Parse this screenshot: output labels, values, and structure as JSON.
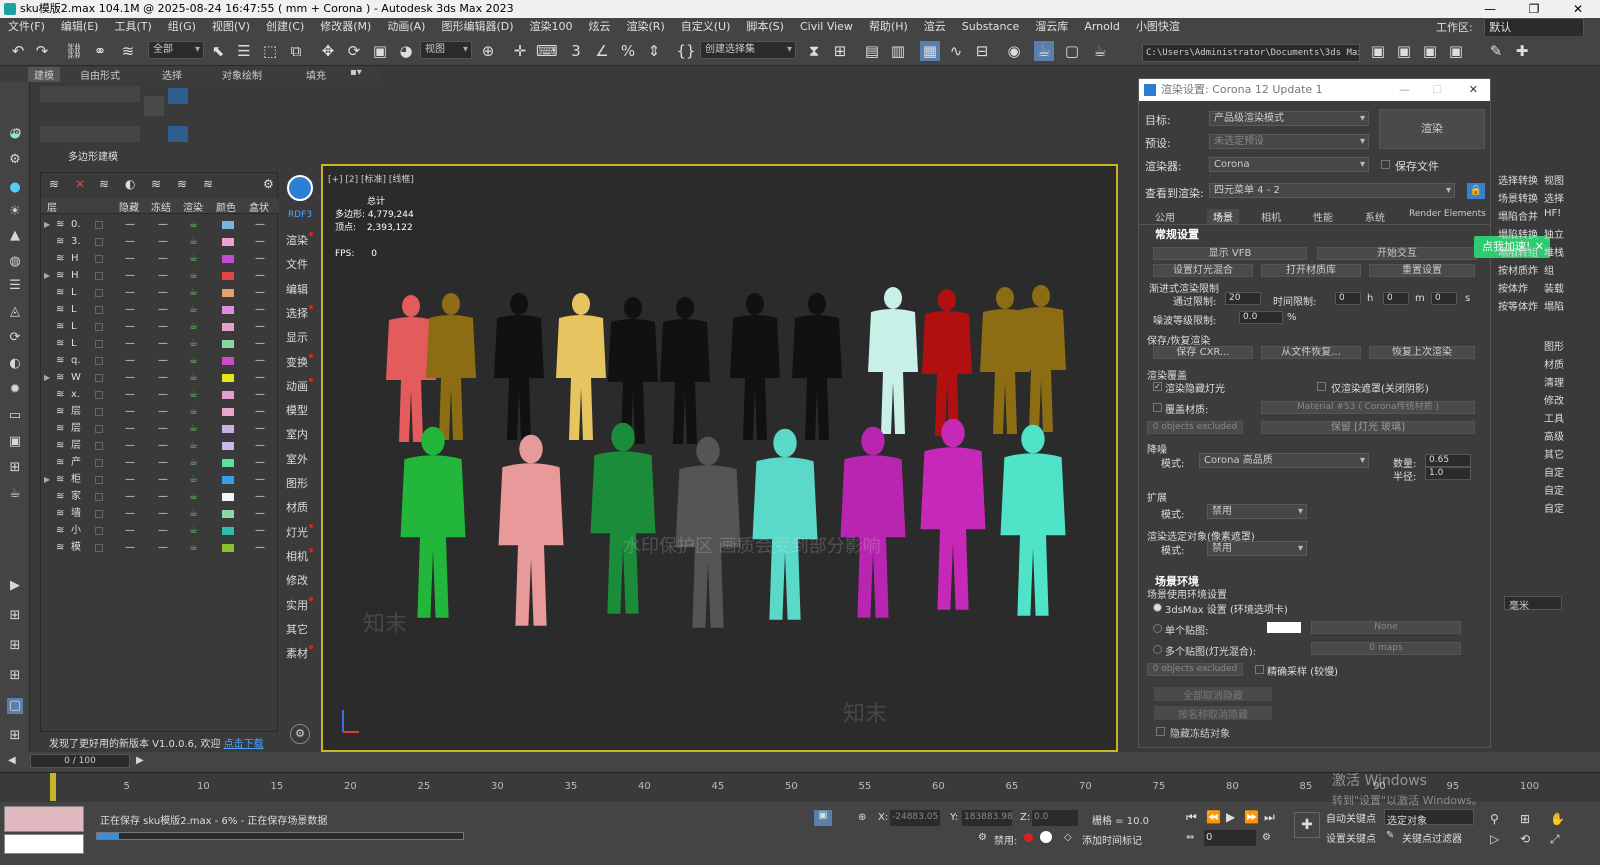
{
  "titlebar": {
    "title": "sku模版2.max   104.1M @ 2025-08-24 16:47:55  ( mm + Corona ) - Autodesk 3ds Max 2023"
  },
  "menubar": {
    "items": [
      "文件(F)",
      "编辑(E)",
      "工具(T)",
      "组(G)",
      "视图(V)",
      "创建(C)",
      "修改器(M)",
      "动画(A)",
      "图形编辑器(D)",
      "渲染100",
      "炫云",
      "渲染(R)",
      "自定义(U)",
      "脚本(S)",
      "Civil View",
      "帮助(H)",
      "渲云",
      "Substance",
      "溜云库",
      "Arnold",
      "小图快渲"
    ],
    "workspace_label": "工作区:",
    "workspace_value": "默认"
  },
  "toolbar": {
    "selection_filter": "全部",
    "ref_coord": "视图",
    "named_selection": "创建选择集",
    "project_path": "C:\\Users\\Administrator\\Documents\\3ds Max 2023"
  },
  "command_tabs": [
    "建模",
    "自由形式",
    "选择",
    "对象绘制",
    "填充"
  ],
  "create_panel": {
    "subtitle": "多边形建模"
  },
  "layer_panel": {
    "columns": [
      "层",
      "隐藏",
      "冻结",
      "渲染",
      "颜色",
      "盒状"
    ],
    "rows": [
      {
        "name": "0.",
        "color": "#7ab4e0",
        "expand": "▶"
      },
      {
        "name": "3.",
        "color": "#e7a3d6",
        "expand": ""
      },
      {
        "name": "H",
        "color": "#c44ccd",
        "expand": ""
      },
      {
        "name": "H",
        "color": "#e04646",
        "expand": "▶"
      },
      {
        "name": "L",
        "color": "#e2a366",
        "expand": ""
      },
      {
        "name": "L",
        "color": "#e08de0",
        "expand": ""
      },
      {
        "name": "L",
        "color": "#e5a0c8",
        "expand": ""
      },
      {
        "name": "L",
        "color": "#88d8a0",
        "expand": ""
      },
      {
        "name": "q.",
        "color": "#c84ccc",
        "expand": ""
      },
      {
        "name": "W",
        "color": "#e6e61c",
        "expand": "▶"
      },
      {
        "name": "x.",
        "color": "#e29fce",
        "expand": ""
      },
      {
        "name": "层",
        "color": "#e6a8cc",
        "expand": ""
      },
      {
        "name": "层",
        "color": "#c8b0e6",
        "expand": ""
      },
      {
        "name": "层",
        "color": "#c6b8e8",
        "expand": ""
      },
      {
        "name": "产",
        "color": "#5ce0a0",
        "expand": ""
      },
      {
        "name": "柜",
        "color": "#3a9fe0",
        "expand": "▶"
      },
      {
        "name": "家",
        "color": "#f4f4f4",
        "expand": ""
      },
      {
        "name": "墙",
        "color": "#8ad8a0",
        "expand": ""
      },
      {
        "name": "小",
        "color": "#2fbcae",
        "expand": ""
      },
      {
        "name": "模",
        "color": "#8abf2e",
        "expand": ""
      }
    ],
    "update_note": "发现了更好用的新版本 V1.0.0.6, 欢迎",
    "update_link": "点击下载"
  },
  "rdf_panel": {
    "title": "RDF3",
    "items": [
      "渲染",
      "文件",
      "编辑",
      "选择",
      "显示",
      "变换",
      "动画",
      "模型",
      "室内",
      "室外",
      "图形",
      "材质",
      "灯光",
      "相机",
      "修改",
      "实用",
      "其它",
      "素材"
    ]
  },
  "viewport": {
    "label": "[+] [2] [标准] [线框]",
    "stats_total": "总计",
    "polys_label": "多边形:",
    "polys": "4,779,244",
    "verts_label": "顶点:",
    "verts": "2,393,122",
    "fps_label": "FPS:",
    "fps": "0",
    "watermark": "水印保护区 画质会受到部分影响",
    "brand_watermark": "知末"
  },
  "render_dialog": {
    "title": "渲染设置: Corona 12 Update 1",
    "target_label": "目标:",
    "target_value": "产品级渲染模式",
    "preset_label": "预设:",
    "preset_value": "未选定预设",
    "renderer_label": "渲染器:",
    "renderer_value": "Corona",
    "save_file": "保存文件",
    "view_label": "查看到渲染:",
    "view_value": "四元菜单 4 - 2",
    "render_button": "渲染",
    "tabs": [
      "公用",
      "场景",
      "相机",
      "性能",
      "系统",
      "Render Elements"
    ],
    "general_section": "常规设置",
    "show_vfb": "显示 VFB",
    "start_interactive": "开始交互",
    "setup_lightmix": "设置灯光混合",
    "open_matlib": "打开材质库",
    "reset_settings": "重置设置",
    "progressive_limit": "渐进式渲染限制",
    "pass_limit_label": "通过限制:",
    "pass_limit": "20",
    "time_limit_label": "时间限制:",
    "h": "0",
    "m": "0",
    "s": "0",
    "h_unit": "h",
    "m_unit": "m",
    "s_unit": "s",
    "noise_label": "噪波等级限制:",
    "noise": "0.0",
    "percent": "%",
    "save_restore": "保存/恢复渲染",
    "save_cxr": "保存 CXR...",
    "resume_file": "从文件恢复...",
    "resume_last": "恢复上次渲染",
    "override_section": "渲染覆盖",
    "render_hidden_lights": "渲染隐藏灯光",
    "render_mask_only": "仅渲染遮罩(关闭阴影)",
    "override_material": "覆盖材质:",
    "override_material_value": "Material #53 ( Corona传统材质 )",
    "objects_excluded": "0 objects excluded",
    "keep_lights": "保留 [灯光 玻璃]",
    "denoise_section": "降噪",
    "denoise_mode_label": "模式:",
    "denoise_mode": "Corona 高品质",
    "amount_label": "数量:",
    "amount": "0.65",
    "radius_label": "半径:",
    "radius": "1.0",
    "extend_section": "扩展",
    "extend_mode_label": "模式:",
    "extend_mode": "禁用",
    "selected_section": "渲染选定对象(像素遮罩)",
    "selected_mode_label": "模式:",
    "selected_mode": "禁用",
    "env_section": "场景环境",
    "env_use": "场景使用环境设置",
    "env_3dsmax": "3dsMax 设置 (环境选项卡)",
    "env_single": "单个贴图:",
    "env_single_map": "None",
    "env_multi": "多个贴图(灯光混合):",
    "env_multi_maps": "0 maps",
    "env_excluded": "0 objects excluded",
    "env_precise": "精确采样 (较慢)"
  },
  "green_button": {
    "label": "点我加速!"
  },
  "right_strip": [
    "选择转换",
    "视图",
    "场景转换",
    "选择",
    "塌陷合并",
    "HF!",
    "塌陷转换",
    "独立",
    "塌陷转组",
    "堆栈",
    "按材质炸",
    "组",
    "按体炸",
    "装载",
    "按等体炸",
    "塌陷",
    "图形",
    "材质",
    "清理",
    "修改",
    "工具",
    "高级",
    "其它",
    "自定",
    "自定",
    "自定"
  ],
  "float_controls": {
    "unit": "毫米"
  },
  "lower_left_buttons": {
    "unhide_all": "全部取消隐藏",
    "unhide_by_name": "按名称取消隐藏",
    "hide_frozen": "隐藏冻结对象"
  },
  "timeline": {
    "slider": "0 / 100",
    "ticks": [
      "0",
      "5",
      "10",
      "15",
      "20",
      "25",
      "30",
      "35",
      "40",
      "45",
      "50",
      "55",
      "60",
      "65",
      "70",
      "75",
      "80",
      "85",
      "90",
      "95",
      "100"
    ]
  },
  "status": {
    "saving": "正在保存 sku模版2.max - 6% - 正在保存场景数据",
    "progress_percent": 6,
    "x_label": "X:",
    "x": "-24883.05",
    "y_label": "Y:",
    "y": "183883.98",
    "z_label": "Z:",
    "z": "0.0",
    "grid": "栅格 = 10.0",
    "disable": "禁用:",
    "add_time_tag": "添加时间标记",
    "auto_key": "自动关键点",
    "set_key": "设置关键点",
    "selected_object": "选定对象",
    "key_filters": "关键点过滤器",
    "frame": "0"
  },
  "activation": {
    "title": "激活 Windows",
    "subtitle": "转到\"设置\"以激活 Windows。"
  },
  "figure_colors": [
    "#e35b5b",
    "#8c6d14",
    "#111111",
    "#e6c560",
    "#111111",
    "#111111",
    "#111111",
    "#111111",
    "#c8f0e6",
    "#b01010",
    "#8c6d14",
    "#8c6d14",
    "#22b73a",
    "#e89a9a",
    "#1a8c3a",
    "#555555",
    "#5ad8c8",
    "#b825b0",
    "#c628b8",
    "#4fe3c8"
  ]
}
